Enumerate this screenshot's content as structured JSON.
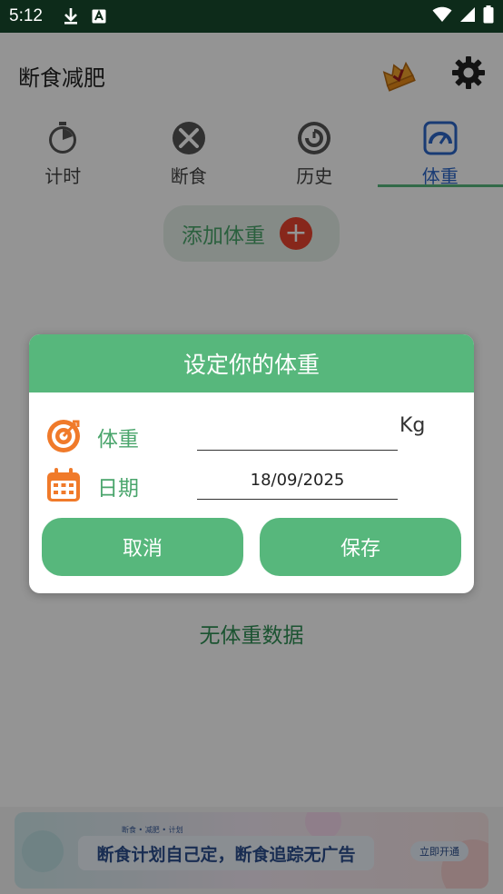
{
  "status_bar": {
    "time": "5:12",
    "icons": [
      "download-icon",
      "a-notification-icon",
      "wifi-icon",
      "signal-icon",
      "battery-icon"
    ]
  },
  "app_bar": {
    "title": "断食减肥",
    "icons": [
      "crown-icon",
      "gear-icon"
    ]
  },
  "tabs": [
    {
      "label": "计时",
      "icon": "stopwatch-icon",
      "active": false
    },
    {
      "label": "断食",
      "icon": "fork-knife-icon",
      "active": false
    },
    {
      "label": "历史",
      "icon": "history-icon",
      "active": false
    },
    {
      "label": "体重",
      "icon": "scale-icon",
      "active": true
    }
  ],
  "content": {
    "add_weight_label": "添加体重",
    "no_data_label": "无体重数据"
  },
  "banner_ad": {
    "small_text": "断食 • 减肥 • 计划",
    "main_text": "断食计划自己定，断食追踪无广告",
    "cta": "立即开通"
  },
  "dialog": {
    "title": "设定你的体重",
    "weight_label": "体重",
    "weight_value": "",
    "weight_unit": "Kg",
    "date_label": "日期",
    "date_value": "18/09/2025",
    "cancel_label": "取消",
    "save_label": "保存"
  },
  "colors": {
    "accent_green": "#57b77c",
    "label_green": "#4aa56c",
    "active_tab_blue": "#2b66c8",
    "plus_red": "#e9442f",
    "icon_orange": "#f07a2a",
    "status_bar_bg": "#0d2b1a"
  }
}
